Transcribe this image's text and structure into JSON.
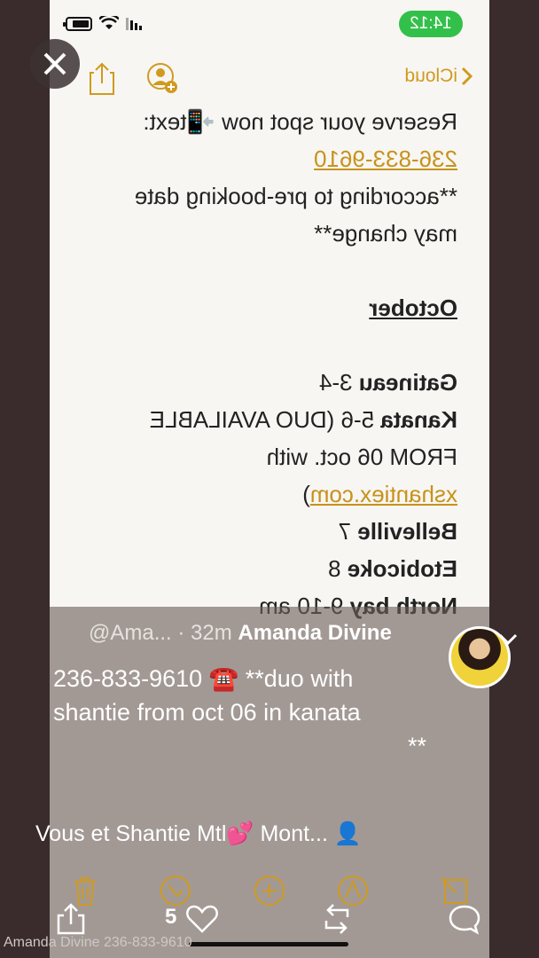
{
  "status_bar": {
    "time": "14:12"
  },
  "toolbar": {
    "back_label": "iCloud"
  },
  "note": {
    "lines": [
      "Reserve your spot now 📲text:",
      "236-833-9610",
      "**according to pre-booking date",
      "may change**"
    ],
    "month": "October",
    "schedule": [
      {
        "city": "Gatineau",
        "dates": " 3-4"
      },
      {
        "city": "Kanata",
        "dates": " 5-6 (DUO AVAILABLE"
      }
    ],
    "duo_line": "FROM 06 oct. with",
    "duo_link": "xshantiex.com",
    "duo_close": ")",
    "schedule2": [
      {
        "city": "Belleville",
        "dates": " 7"
      },
      {
        "city": "Etobicoke",
        "dates": " 8"
      },
      {
        "city": "North bay",
        "dates": " 9-10 am"
      }
    ]
  },
  "post": {
    "author": "Amanda Divine",
    "meta": "@Ama... · 32m",
    "caption_lines": [
      "236-833-9610 ☎️ **duo with",
      "shantie from oct 06  in kanata",
      "**"
    ],
    "music": "Vous et Shantie Mtl💕 Mont..."
  },
  "actions": {
    "like_count": "5"
  },
  "watermark": "Amanda Divine 236-833-9610",
  "colors": {
    "accent": "#c8921a",
    "time_pill": "#33c04a",
    "background": "#3a2b2c"
  }
}
